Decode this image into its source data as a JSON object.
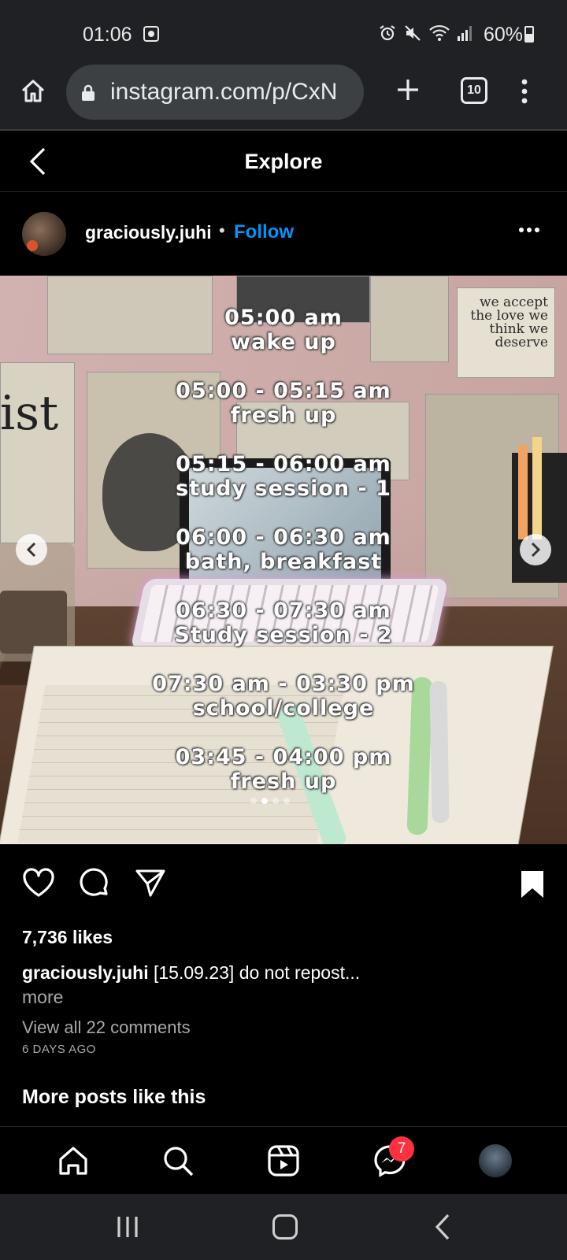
{
  "status_bar": {
    "time": "01:06",
    "battery": "60%"
  },
  "browser": {
    "url": "instagram.com/p/CxN",
    "tab_count": "10"
  },
  "ig_header": {
    "title": "Explore"
  },
  "post": {
    "username": "graciously.juhi",
    "separator": "•",
    "follow_label": "Follow",
    "schedule": [
      {
        "time": "05:00 am",
        "activity": "wake up"
      },
      {
        "time": "05:00 - 05:15 am",
        "activity": "fresh up"
      },
      {
        "time": "05:15 - 06:00 am",
        "activity": "study session - 1"
      },
      {
        "time": "06:00 - 06:30 am",
        "activity": "bath, breakfast"
      },
      {
        "time": "06:30 - 07:30 am",
        "activity": "Study session - 2"
      },
      {
        "time": "07:30 am - 03:30 pm",
        "activity": "school/college"
      },
      {
        "time": "03:45 - 04:00 pm",
        "activity": "fresh up"
      }
    ],
    "poster_quote": "we accept the love we think we deserve",
    "poster_big_text": "ist",
    "carousel": {
      "total": 4,
      "active_index": 1
    },
    "likes": "7,736 likes",
    "caption_user": "graciously.juhi",
    "caption_text": "[15.09.23] do not repost...",
    "more_label": "more",
    "view_comments": "View all 22 comments",
    "time_ago": "6 DAYS AGO"
  },
  "section": {
    "more_posts": "More posts like this"
  },
  "bottom_nav": {
    "messages_badge": "7"
  },
  "colors": {
    "accent": "#0095f6",
    "badge": "#ff3040",
    "chrome_bg": "#202124"
  }
}
